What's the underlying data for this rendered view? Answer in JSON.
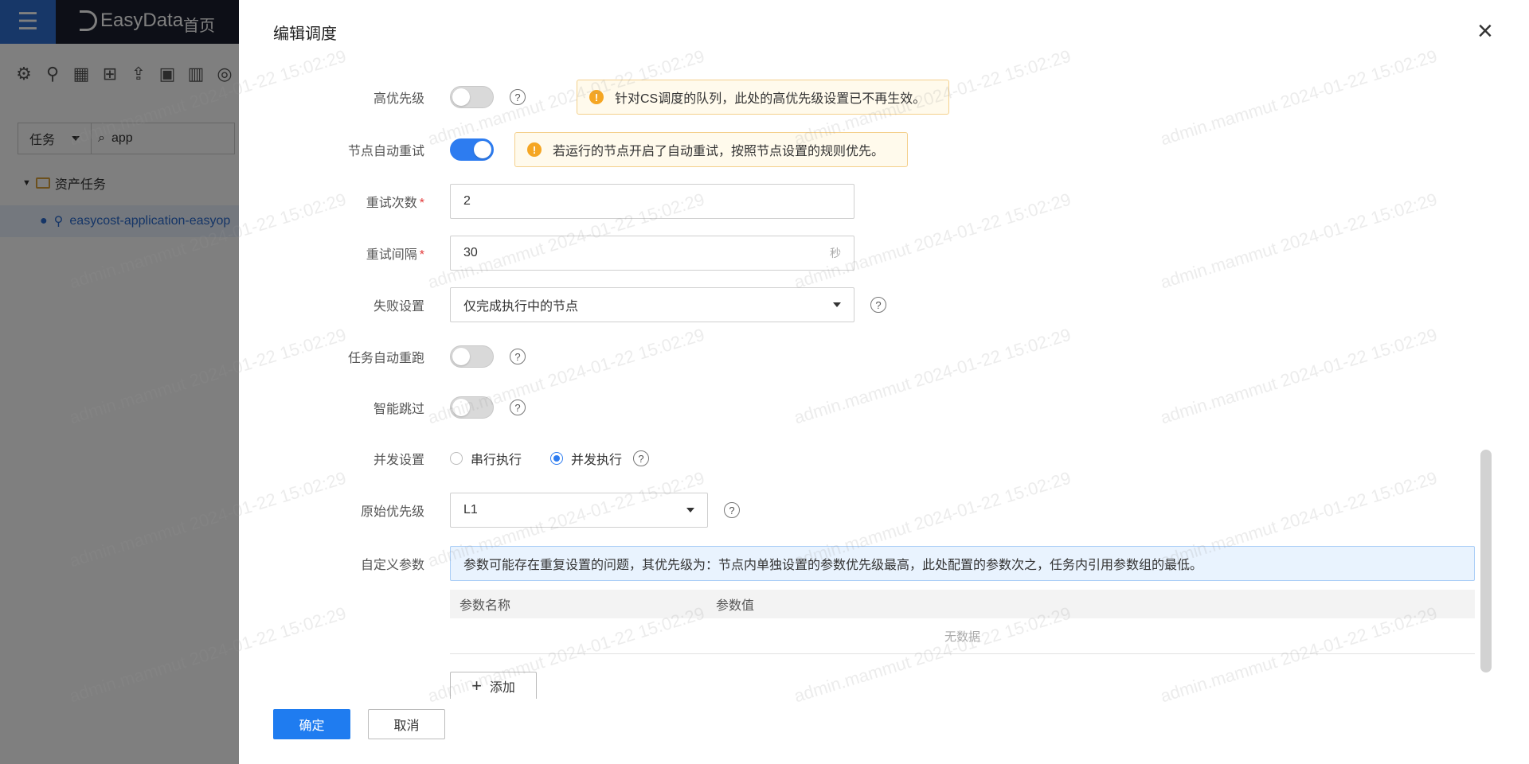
{
  "background": {
    "brand": "EasyData",
    "nav_home": "首页",
    "filter_type": "任务",
    "search_value": "app",
    "tree_root": "资产任务",
    "tree_item": "easycost-application-easyop"
  },
  "drawer": {
    "title": "编辑调度",
    "rows": {
      "high_priority": {
        "label": "高优先级",
        "enabled": false,
        "warning": "针对CS调度的队列，此处的高优先级设置已不再生效。"
      },
      "node_auto_retry": {
        "label": "节点自动重试",
        "enabled": true,
        "warning": "若运行的节点开启了自动重试，按照节点设置的规则优先。"
      },
      "retry_count": {
        "label": "重试次数",
        "required_mark": "*",
        "value": "2"
      },
      "retry_interval": {
        "label": "重试间隔",
        "required_mark": "*",
        "value": "30",
        "suffix": "秒"
      },
      "failure_setting": {
        "label": "失败设置",
        "value": "仅完成执行中的节点"
      },
      "task_auto_rerun": {
        "label": "任务自动重跑",
        "enabled": false
      },
      "smart_skip": {
        "label": "智能跳过",
        "enabled": false
      },
      "concurrency": {
        "label": "并发设置",
        "options": [
          "串行执行",
          "并发执行"
        ],
        "selected": "并发执行"
      },
      "original_priority": {
        "label": "原始优先级",
        "value": "L1"
      },
      "custom_params": {
        "label": "自定义参数",
        "info": "参数可能存在重复设置的问题，其优先级为：节点内单独设置的参数优先级最高，此处配置的参数次之，任务内引用参数组的最低。",
        "columns": [
          "参数名称",
          "参数值"
        ],
        "empty_text": "无数据",
        "add_label": "添加"
      }
    },
    "footer": {
      "confirm": "确定",
      "cancel": "取消"
    }
  },
  "watermark_text": "admin.mammut 2024-01-22 15:02:29",
  "colors": {
    "primary": "#1f7cf0",
    "switch_on": "#2d7cf0",
    "warning_bg": "#fffaec",
    "warning_icon": "#f5a623",
    "info_bg": "#e9f3fe",
    "brand_menu": "#2f6fd0"
  }
}
